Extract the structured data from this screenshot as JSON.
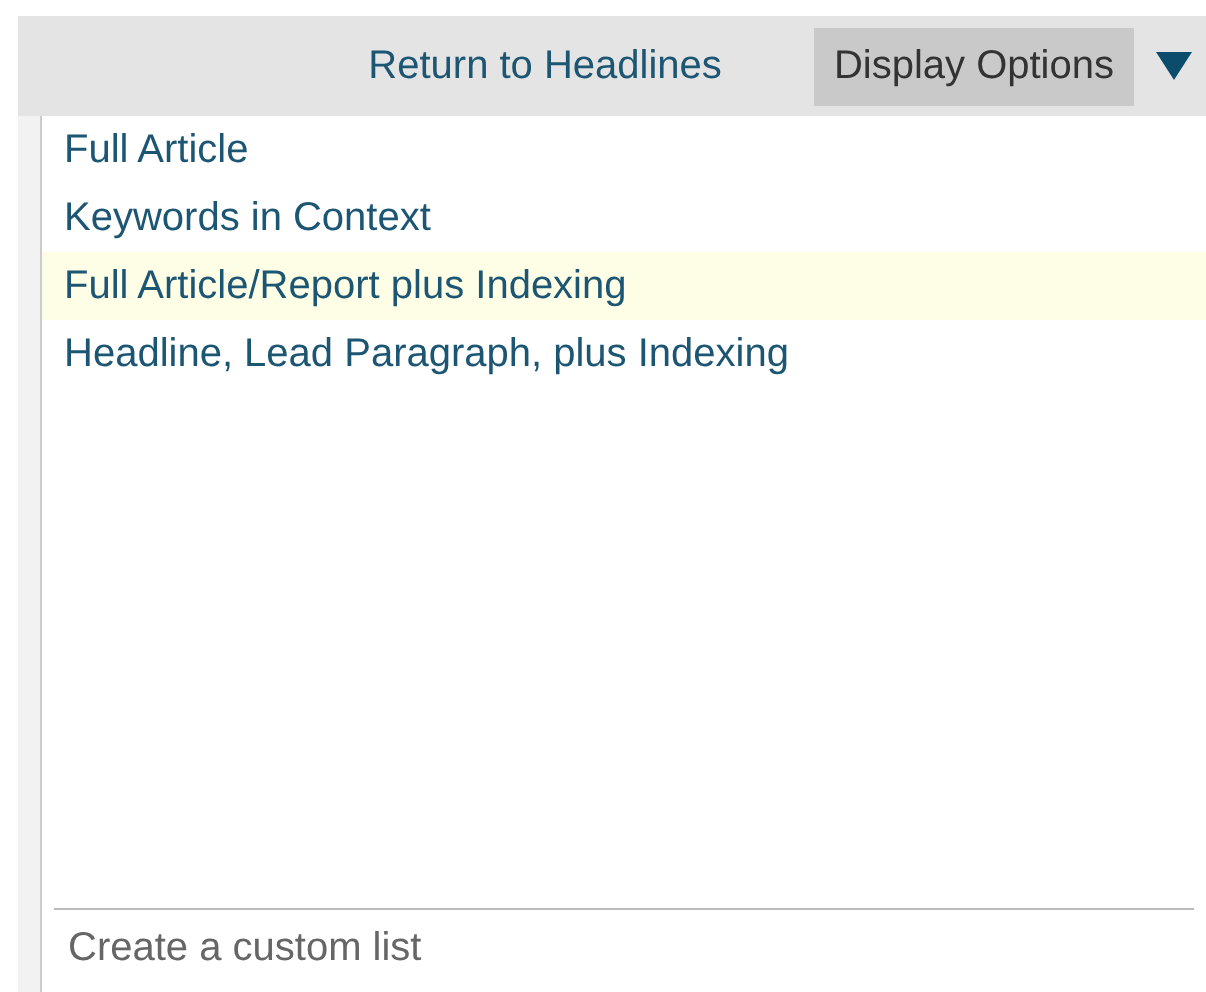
{
  "toolbar": {
    "return_link": "Return to Headlines",
    "display_options": {
      "label": "Display Options",
      "expanded": true
    }
  },
  "menu": {
    "items": [
      {
        "label": "Full Article",
        "highlighted": false
      },
      {
        "label": "Keywords in Context",
        "highlighted": false
      },
      {
        "label": "Full Article/Report plus Indexing",
        "highlighted": true
      },
      {
        "label": "Headline, Lead Paragraph, plus Indexing",
        "highlighted": false
      }
    ],
    "footer": "Create a custom list"
  }
}
